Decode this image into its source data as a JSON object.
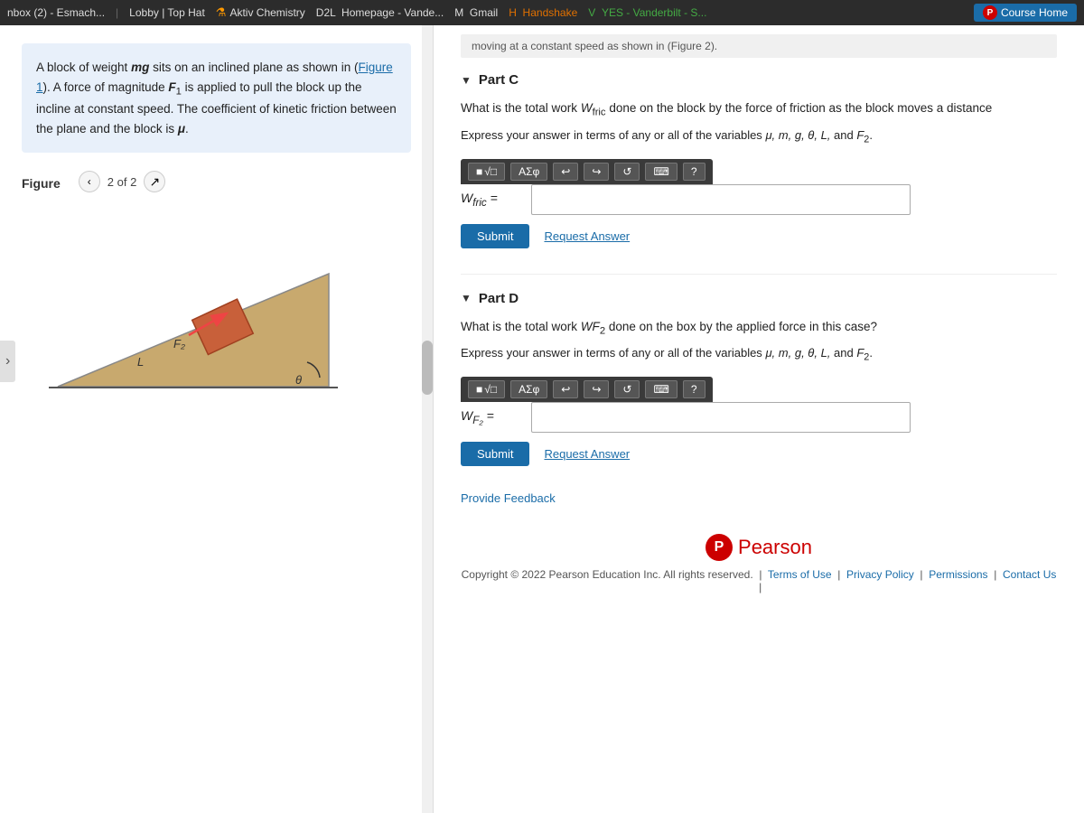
{
  "topbar": {
    "items": [
      {
        "label": "nbox (2) - Esmach...",
        "active": false
      },
      {
        "label": "Lobby | Top Hat",
        "active": false
      },
      {
        "label": "Aktiv Chemistry",
        "active": false
      },
      {
        "label": "D2L  Homepage - Vande...",
        "active": false
      },
      {
        "label": "M  Gmail",
        "active": false
      },
      {
        "label": "H  Handshake",
        "active": false
      },
      {
        "label": "V  YES - Vanderbilt - S...",
        "active": false
      }
    ],
    "course_home": "Course Home"
  },
  "left_panel": {
    "problem_text": "A block of weight mg sits on an inclined plane as shown in (Figure 1). A force of magnitude F₁ is applied to pull the block up the incline at constant speed. The coefficient of kinetic friction between the plane and the block is μ.",
    "figure_label": "Figure",
    "figure_nav": "2 of 2"
  },
  "right_panel": {
    "top_strip": "moving at a constant speed as shown in (Figure 2).",
    "part_c": {
      "label": "Part C",
      "question": "What is the total work Wₜᵣᵢᶜ done on the block by the force of friction as the block moves a distance",
      "sub_question": "Express your answer in terms of any or all of the variables μ, m, g, θ, L, and F₂.",
      "toolbar": {
        "sqrt_label": "√□",
        "aso_label": "AΣφ",
        "undo_label": "↩",
        "redo_label": "↪",
        "refresh_label": "↺",
        "keyboard_label": "⌨",
        "help_label": "?"
      },
      "var_label": "Wₜᵣᵢᶜ =",
      "input_placeholder": "",
      "submit_label": "Submit",
      "request_label": "Request Answer"
    },
    "part_d": {
      "label": "Part D",
      "question": "What is the total work WF₂ done on the box by the applied force in this case?",
      "sub_question": "Express your answer in terms of any or all of the variables μ, m, g, θ, L, and F₂.",
      "toolbar": {
        "sqrt_label": "√□",
        "aso_label": "AΣφ",
        "undo_label": "↩",
        "redo_label": "↪",
        "refresh_label": "↺",
        "keyboard_label": "⌨",
        "help_label": "?"
      },
      "var_label": "Wₜ₂ =",
      "input_placeholder": "",
      "submit_label": "Submit",
      "request_label": "Request Answer"
    },
    "provide_feedback": "Provide Feedback",
    "footer": {
      "pearson_p": "P",
      "pearson_text": "Pearson",
      "copyright": "Copyright © 2022 Pearson Education Inc. All rights reserved.",
      "terms": "Terms of Use",
      "privacy": "Privacy Policy",
      "permissions": "Permissions",
      "contact": "Contact Us"
    }
  }
}
